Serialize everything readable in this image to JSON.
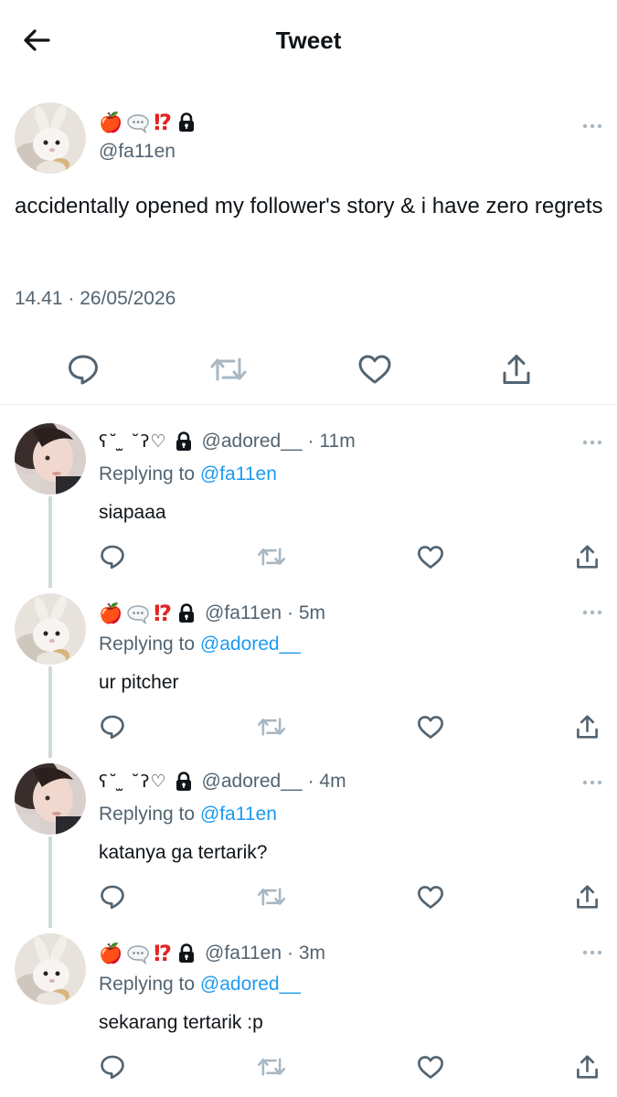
{
  "header": {
    "title": "Tweet"
  },
  "main_tweet": {
    "display_name_emoji": [
      "🍎",
      "💬",
      "⁉"
    ],
    "handle": "@fa11en",
    "text": "accidentally opened my follower's story & i have zero regrets",
    "timestamp": "14.41 · 26/05/2026"
  },
  "replies": [
    {
      "author_type": "kaomoji",
      "display_name": "ʕ˘ ̫ ˘ʔ♡",
      "handle": "@adored__",
      "time": "· 11m",
      "replying_label": "Replying to",
      "replying_to": "@fa11en",
      "text": "siapaaa"
    },
    {
      "author_type": "emoji",
      "display_name_emoji": [
        "🍎",
        "💬",
        "⁉"
      ],
      "handle": "@fa11en",
      "time": "· 5m",
      "replying_label": "Replying to",
      "replying_to": "@adored__",
      "text": "ur pitcher"
    },
    {
      "author_type": "kaomoji",
      "display_name": "ʕ˘ ̫ ˘ʔ♡",
      "handle": "@adored__",
      "time": "· 4m",
      "replying_label": "Replying to",
      "replying_to": "@fa11en",
      "text": "katanya ga tertarik?"
    },
    {
      "author_type": "emoji",
      "display_name_emoji": [
        "🍎",
        "💬",
        "⁉"
      ],
      "handle": "@fa11en",
      "time": "· 3m",
      "replying_label": "Replying to",
      "replying_to": "@adored__",
      "text": "sekarang tertarik :p"
    }
  ],
  "icons": {
    "back": "arrow-left-icon",
    "lock": "lock-icon",
    "more": "more-dots-icon",
    "reply": "reply-bubble-icon",
    "retweet": "retweet-icon",
    "like": "heart-icon",
    "share": "share-icon"
  },
  "colors": {
    "text": "#0f1419",
    "secondary": "#536471",
    "link": "#1d9bf0",
    "divider": "#e6ecf0",
    "thread_line": "#cfd9de",
    "retweet_icon": "#a8b8c4"
  }
}
